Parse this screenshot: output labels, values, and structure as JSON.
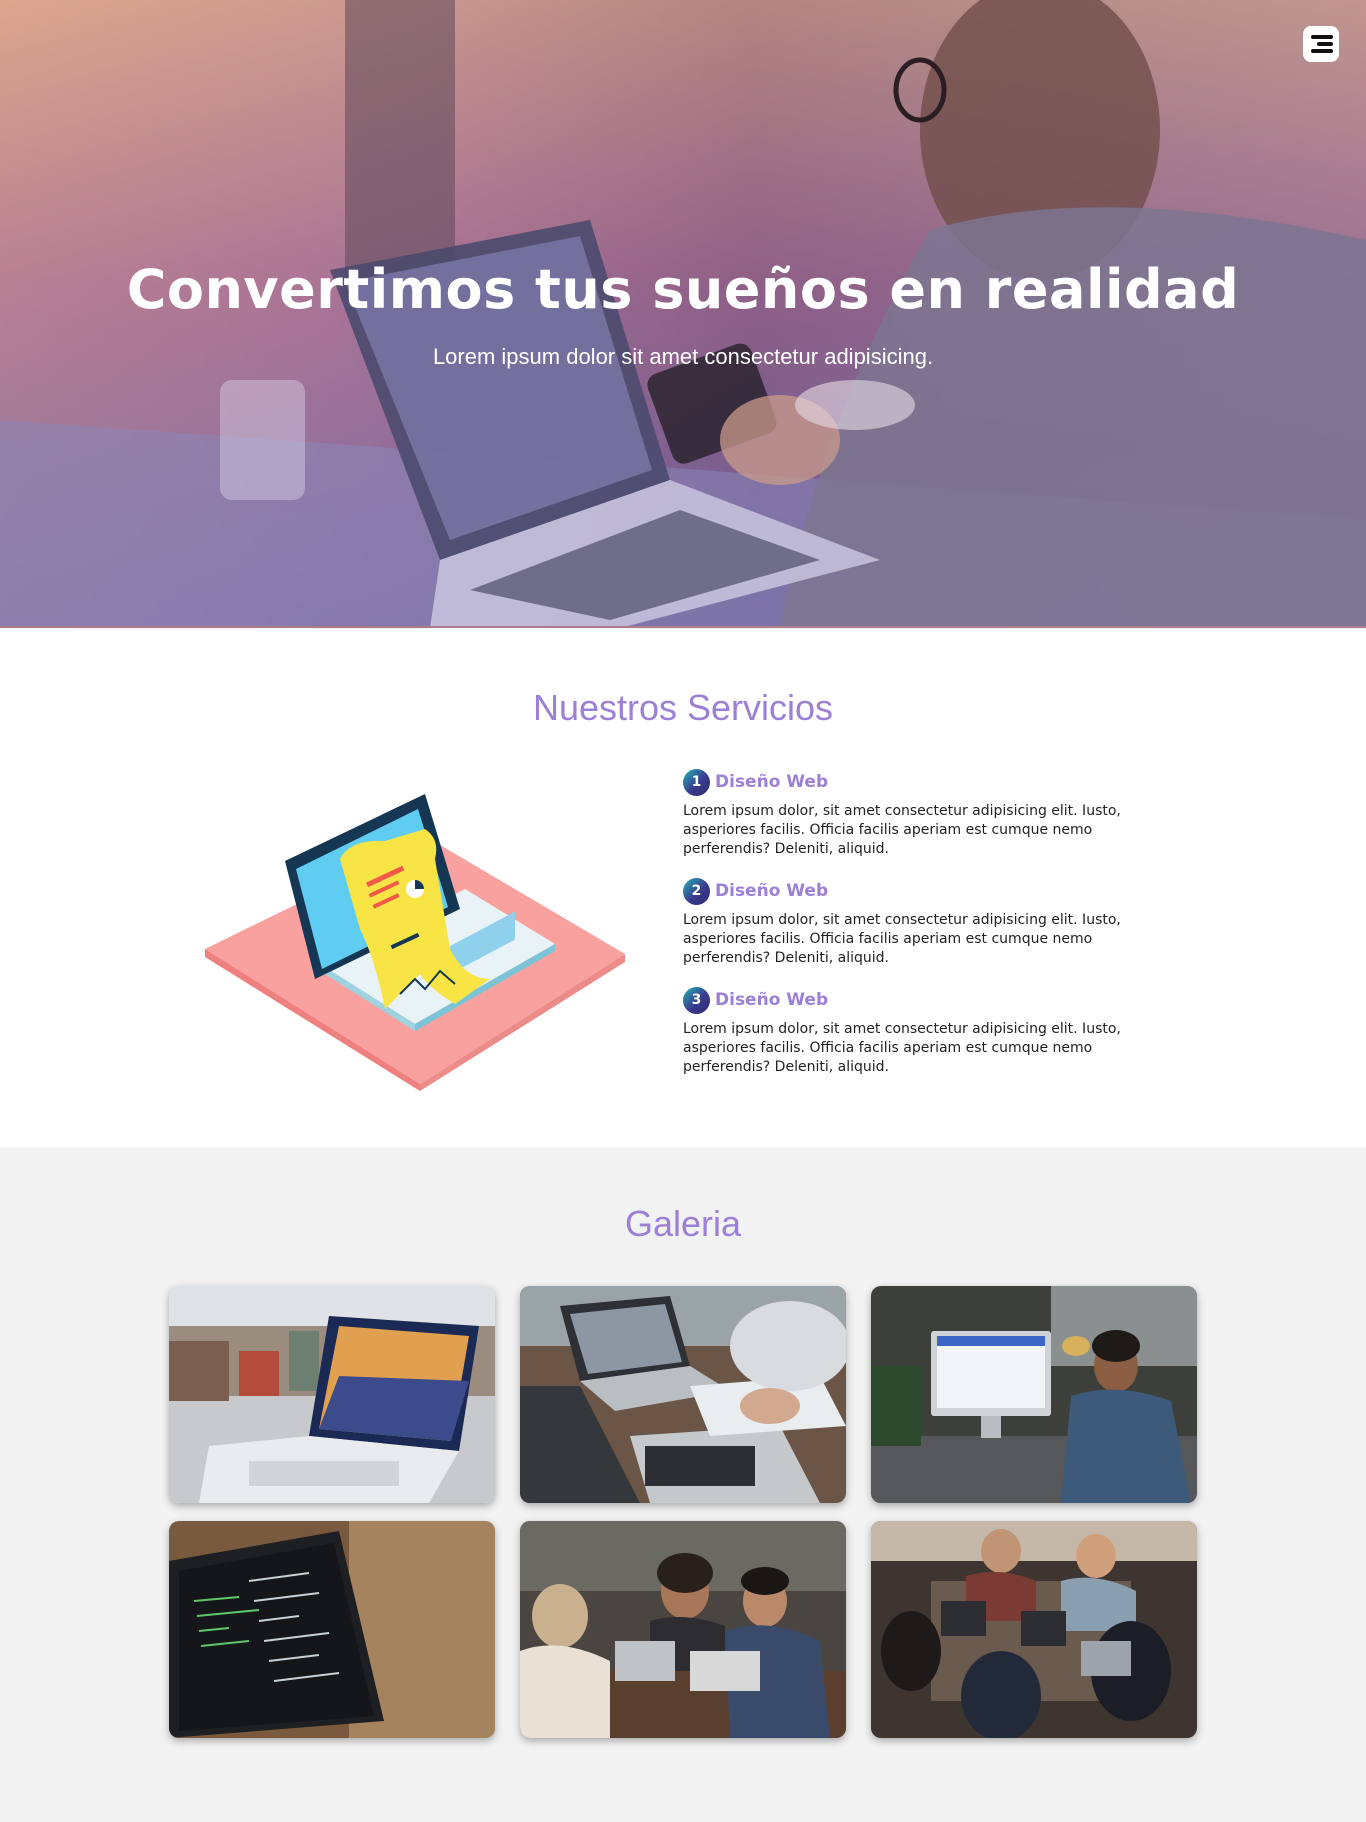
{
  "hero": {
    "title": "Convertimos tus sueños en realidad",
    "subtitle": "Lorem ipsum dolor sit amet consectetur adipisicing.",
    "menu_icon": "hamburger-menu-icon"
  },
  "services": {
    "title": "Nuestros Servicios",
    "illustration": "laptop-receipt-illustration",
    "items": [
      {
        "number": "1",
        "name": "Diseño Web",
        "description": "Lorem ipsum dolor, sit amet consectetur adipisicing elit. Iusto, asperiores facilis. Officia facilis aperiam est cumque nemo perferendis? Deleniti, aliquid."
      },
      {
        "number": "2",
        "name": "Diseño Web",
        "description": "Lorem ipsum dolor, sit amet consectetur adipisicing elit. Iusto, asperiores facilis. Officia facilis aperiam est cumque nemo perferendis? Deleniti, aliquid."
      },
      {
        "number": "3",
        "name": "Diseño Web",
        "description": "Lorem ipsum dolor, sit amet consectetur adipisicing elit. Iusto, asperiores facilis. Officia facilis aperiam est cumque nemo perferendis? Deleniti, aliquid."
      }
    ]
  },
  "gallery": {
    "title": "Galeria",
    "photos": [
      "laptop-city-photo",
      "meeting-laptops-photo",
      "man-imac-photo",
      "code-laptop-photo",
      "friends-cafe-photo",
      "team-coworking-photo"
    ]
  },
  "colors": {
    "accent": "#9c7fd6",
    "badge_gradient_start": "#20b6b6",
    "badge_gradient_end": "#2c2c6e",
    "gallery_bg": "#f2f2f2"
  }
}
